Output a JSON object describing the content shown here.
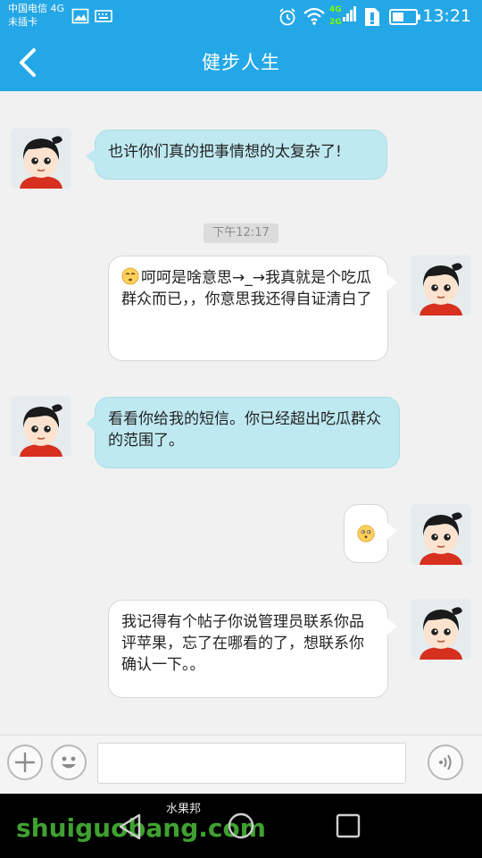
{
  "status_bar": {
    "carrier_line1": "中国电信 4G",
    "carrier_line2": "未插卡",
    "network_4g": "4G",
    "network_2g": "2G",
    "time": "13:21"
  },
  "header": {
    "title": "健步人生"
  },
  "chat": {
    "timestamp": "下午12:17",
    "messages": [
      {
        "direction": "incoming",
        "text": "也许你们真的把事情想的太复杂了!"
      },
      {
        "direction": "outgoing",
        "emoji": "face-emoji",
        "text": "呵呵是啥意思→_→我真就是个吃瓜群众而已，，你意思我还得自证清白了"
      },
      {
        "direction": "incoming",
        "text": "看看你给我的短信。你已经超出吃瓜群众的范围了。"
      },
      {
        "direction": "outgoing",
        "emoji": "thinking-face-emoji",
        "text": ""
      },
      {
        "direction": "outgoing",
        "text": "我记得有个帖子你说管理员联系你品评苹果，忘了在哪看的了，想联系你确认一下。。"
      }
    ]
  },
  "input_bar": {
    "value": "",
    "placeholder": ""
  },
  "watermark": {
    "text": "shuiguobang.com",
    "cn_text": "水果邦"
  },
  "colors": {
    "primary": "#24a7e6",
    "incoming_bubble": "#bfe9f1",
    "outgoing_bubble": "#ffffff",
    "watermark": "#3fa130"
  }
}
